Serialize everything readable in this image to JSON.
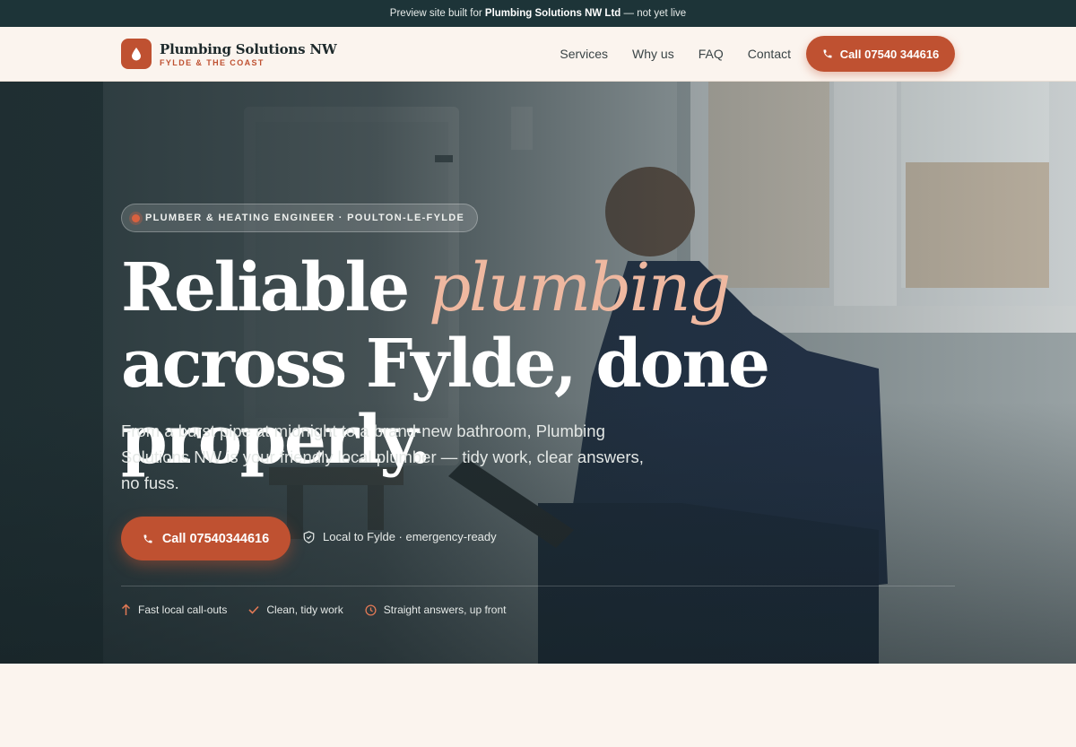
{
  "preview_bar": {
    "prefix": "Preview site built for",
    "company": "Plumbing Solutions NW Ltd",
    "suffix": "— not yet live"
  },
  "header": {
    "brand_name": "Plumbing Solutions NW",
    "brand_tagline": "FYLDE & THE COAST",
    "nav": [
      "Services",
      "Why us",
      "FAQ",
      "Contact"
    ],
    "call_label": "Call 07540 344616"
  },
  "hero": {
    "pill": "PLUMBER & HEATING ENGINEER · POULTON-LE-FYLDE",
    "headline_before": "Reliable",
    "headline_em": "plumbing",
    "headline_after": "across Fylde, done properly.",
    "lede": "From a burst pipe at midnight to a brand-new bathroom, Plumbing Solutions NW is your friendly local plumber — tidy work, clear answers, no fuss.",
    "call_label": "Call 07540344616",
    "local_note": "Local to Fylde · emergency-ready",
    "features": [
      "Fast local call-outs",
      "Clean, tidy work",
      "Straight answers, up front"
    ]
  },
  "icons": {
    "logo": "water-drop-icon",
    "phone": "phone-icon",
    "shield": "shield-check-icon",
    "features": [
      "arrow-up-icon",
      "check-icon",
      "clock-icon"
    ]
  },
  "colors": {
    "accent": "#bf5131",
    "dark": "#1d3438",
    "cream": "#fbf4ee",
    "headline_em": "#efb8a0"
  }
}
